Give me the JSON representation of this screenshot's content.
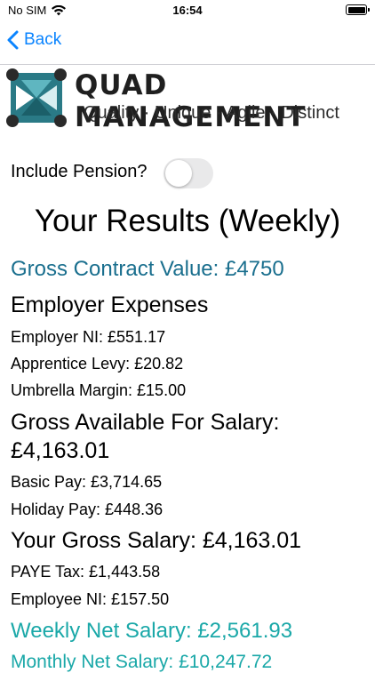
{
  "status": {
    "carrier": "No SIM",
    "time": "16:54"
  },
  "nav": {
    "back_label": "Back"
  },
  "brand": {
    "title": "QUAD MANAGEMENT",
    "tagline": "Quality · Unique · Agile · Distinct"
  },
  "pension": {
    "label": "Include Pension?",
    "enabled": false
  },
  "results": {
    "title": "Your Results (Weekly)",
    "gross_contract": "Gross Contract Value: £4750",
    "employer_heading": "Employer Expenses",
    "employer_ni": "Employer NI: £551.17",
    "apprentice_levy": "Apprentice Levy: £20.82",
    "umbrella_margin": "Umbrella Margin: £15.00",
    "gross_available_line1": "Gross Available For Salary:",
    "gross_available_line2": "£4,163.01",
    "basic_pay": "Basic Pay: £3,714.65",
    "holiday_pay": "Holiday Pay: £448.36",
    "gross_salary": "Your Gross Salary: £4,163.01",
    "paye_tax": "PAYE Tax: £1,443.58",
    "employee_ni": "Employee NI: £157.50",
    "weekly_net": "Weekly Net Salary: £2,561.93",
    "monthly_net": "Monthly Net Salary: £10,247.72"
  },
  "colors": {
    "accent": "#0a84ff",
    "contract": "#1a6f8e",
    "net": "#1aa8a8"
  }
}
